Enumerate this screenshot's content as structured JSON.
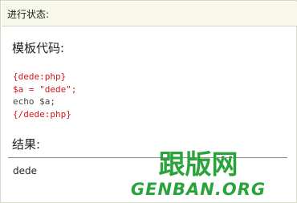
{
  "header": {
    "title": "进行状态:"
  },
  "template_section": {
    "title": "模板代码:",
    "code_lines": [
      "{dede:php}",
      "$a = \"dede\";",
      "echo $a;",
      "{/dede:php}"
    ],
    "code_colors": [
      "#d4151b",
      "#d4151b",
      "#444444",
      "#d4151b"
    ]
  },
  "result_section": {
    "title": "结果:",
    "output": "dede"
  },
  "watermark": {
    "chinese": "跟版网",
    "latin": "GENBAN.ORG",
    "color": "#2aa33b"
  }
}
